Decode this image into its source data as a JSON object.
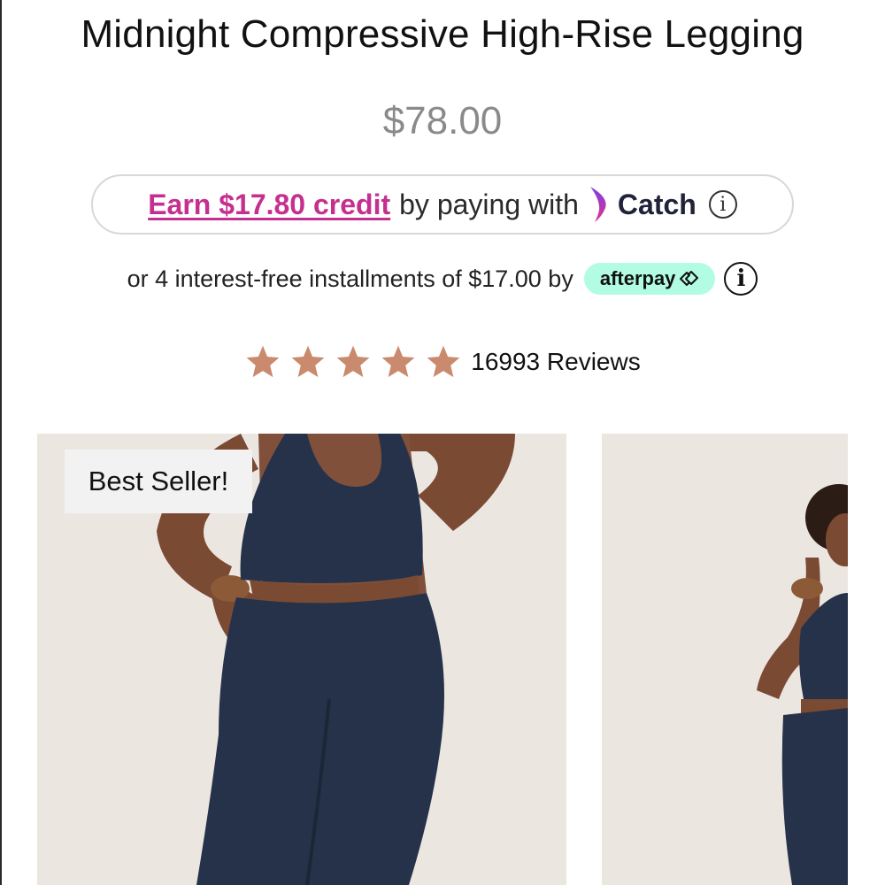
{
  "product": {
    "title": "Midnight Compressive High-Rise Legging",
    "price": "$78.00"
  },
  "catch": {
    "earn_text": "Earn $17.80 credit",
    "by_text": "by paying with",
    "brand": "Catch",
    "info_glyph": "i",
    "brand_color": "#c4308f"
  },
  "afterpay": {
    "text": "or 4 interest-free installments of $17.00 by",
    "badge": "afterpay",
    "info_glyph": "i",
    "badge_color": "#b2fce4"
  },
  "rating": {
    "stars": 5,
    "star_color": "#c98a6e",
    "reviews": "16993 Reviews"
  },
  "gallery": {
    "badge": "Best Seller!",
    "images": [
      "model-front-photo",
      "model-side-photo"
    ]
  }
}
